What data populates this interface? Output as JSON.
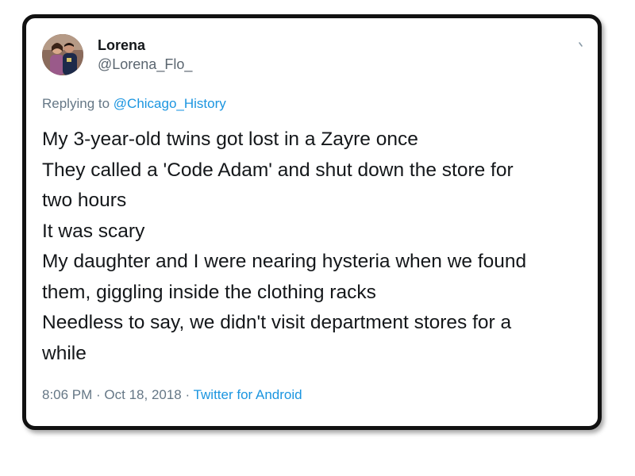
{
  "tweet": {
    "author": {
      "name": "Lorena",
      "handle": "@Lorena_Flo_",
      "avatar_icon": "profile-photo"
    },
    "reply": {
      "prefix": "Replying to ",
      "mention": "@Chicago_History"
    },
    "text_lines": [
      "My 3-year-old twins got lost in a Zayre once",
      "They called a 'Code Adam' and shut down the store for",
      "two hours",
      "It was scary",
      "My daughter and I were nearing hysteria when we found",
      "them, giggling inside the clothing racks",
      "Needless to say, we didn't visit department stores for a",
      "while"
    ],
    "meta": {
      "time": "8:06 PM",
      "separator": " · ",
      "date": "Oct 18, 2018",
      "source": "Twitter for Android"
    },
    "menu_icon": "chevron-down-icon"
  },
  "colors": {
    "text": "#14171a",
    "muted": "#657786",
    "link": "#1b95e0",
    "frame_border": "#111111"
  }
}
